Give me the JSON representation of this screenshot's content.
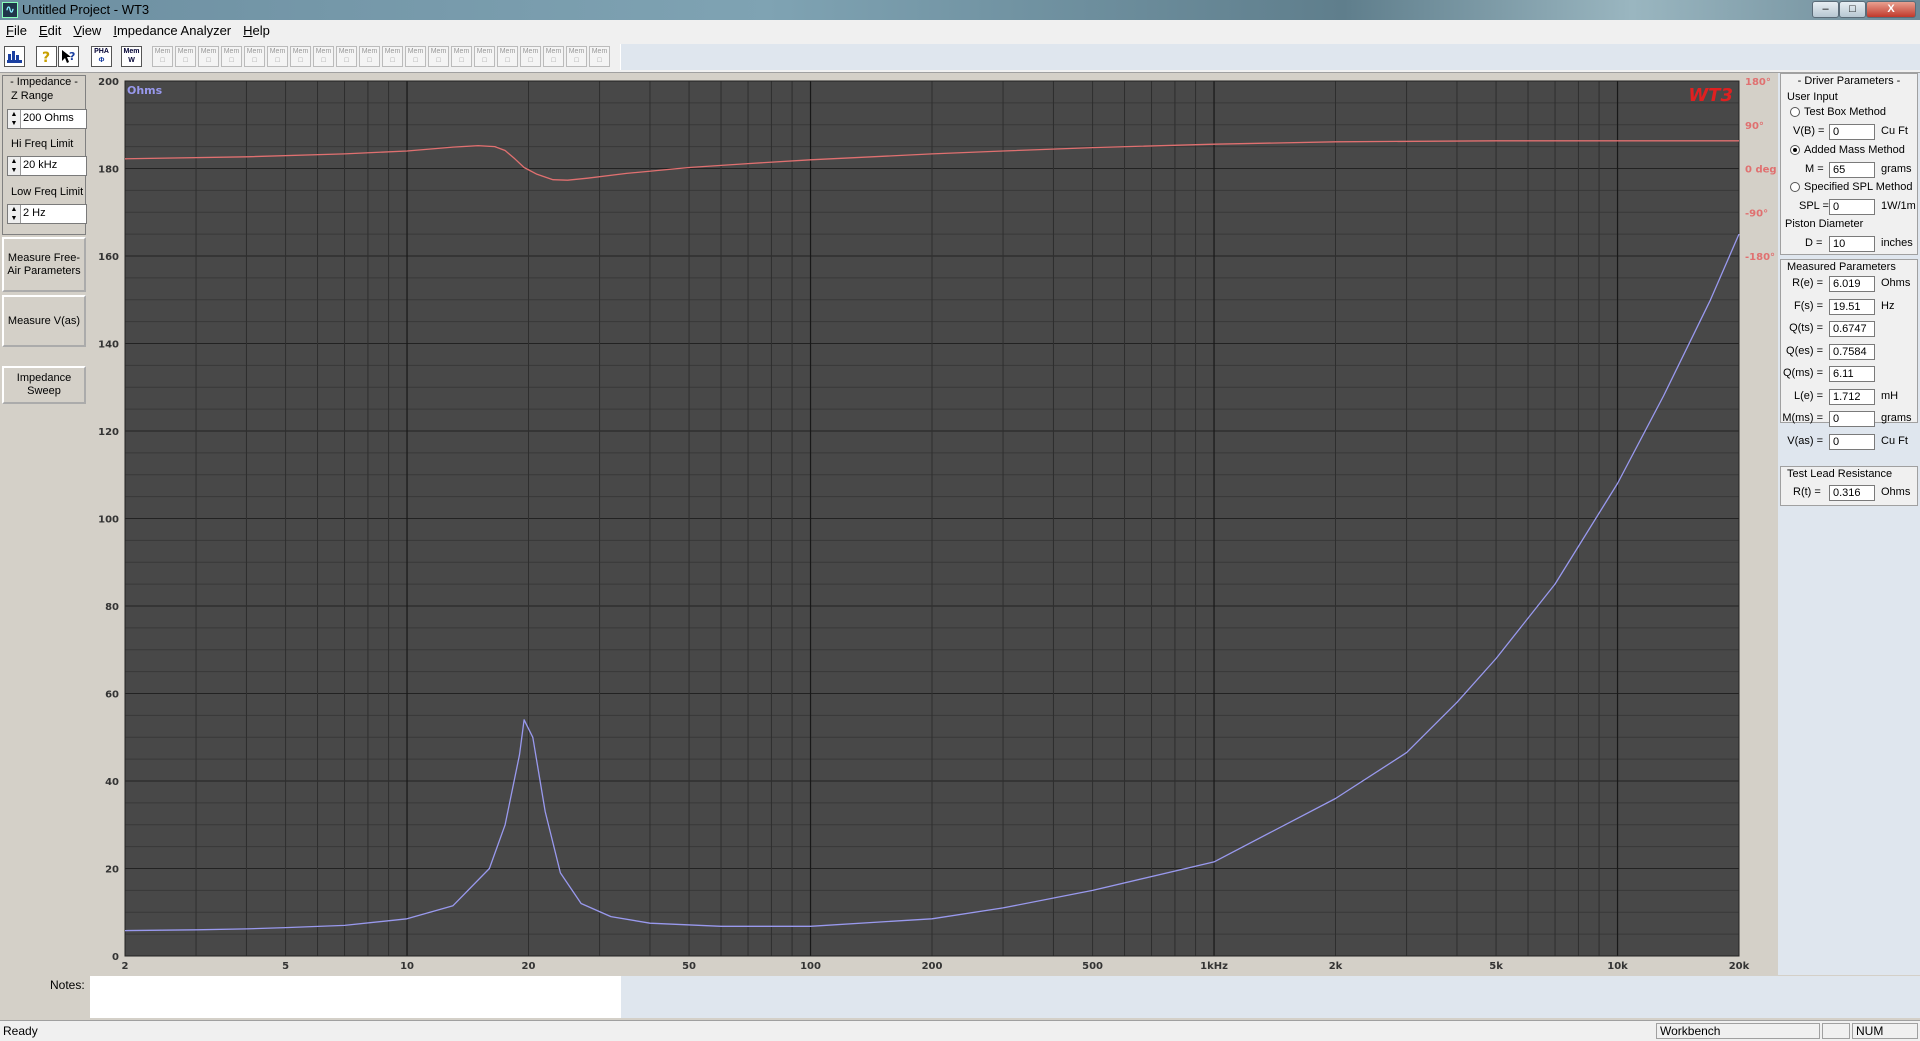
{
  "window": {
    "title": "Untitled Project - WT3",
    "min_glyph": "–",
    "max_glyph": "□",
    "close_glyph": "X"
  },
  "menu": [
    {
      "label": "File",
      "u": "F",
      "rest": "ile"
    },
    {
      "label": "Edit",
      "u": "E",
      "rest": "dit"
    },
    {
      "label": "View",
      "u": "V",
      "rest": "iew"
    },
    {
      "label": "Impedance Analyzer",
      "u": "I",
      "rest": "mpedance Analyzer"
    },
    {
      "label": "Help",
      "u": "H",
      "rest": "elp"
    }
  ],
  "toolbar": {
    "icons": [
      "graph-icon",
      "help-icon",
      "context-help-icon"
    ],
    "pha_label": "PHA",
    "mem_w_label": "Mem W",
    "mem_label": "Mem"
  },
  "left": {
    "group_title": "- Impedance -",
    "z_range_label": "Z Range",
    "z_range_value": "200 Ohms",
    "hi_freq_label": "Hi Freq Limit",
    "hi_freq_value": "20 kHz",
    "low_freq_label": "Low Freq Limit",
    "low_freq_value": "2 Hz",
    "measure_free_air": "Measure Free-Air Parameters",
    "measure_vas": "Measure V(as)",
    "impedance_sweep": "Impedance Sweep"
  },
  "chart_data": {
    "type": "line",
    "logo": "WT3",
    "ylabel": "Ohms",
    "ylim": [
      0,
      200
    ],
    "y_ticks": [
      0,
      20,
      40,
      60,
      80,
      100,
      120,
      140,
      160,
      180,
      200
    ],
    "x_scale": "log",
    "xlim": [
      2,
      20000
    ],
    "x_ticks": [
      {
        "v": 2,
        "label": "2"
      },
      {
        "v": 5,
        "label": "5"
      },
      {
        "v": 10,
        "label": "10"
      },
      {
        "v": 20,
        "label": "20"
      },
      {
        "v": 50,
        "label": "50"
      },
      {
        "v": 100,
        "label": "100"
      },
      {
        "v": 200,
        "label": "200"
      },
      {
        "v": 500,
        "label": "500"
      },
      {
        "v": 1000,
        "label": "1kHz"
      },
      {
        "v": 2000,
        "label": "2k"
      },
      {
        "v": 5000,
        "label": "5k"
      },
      {
        "v": 10000,
        "label": "10k"
      },
      {
        "v": 20000,
        "label": "20k"
      }
    ],
    "phase_ticks": [
      {
        "v": 180,
        "label": "180°"
      },
      {
        "v": 90,
        "label": "90°"
      },
      {
        "v": 0,
        "label": "0 deg"
      },
      {
        "v": -90,
        "label": "-90°"
      },
      {
        "v": -180,
        "label": "-180°"
      }
    ],
    "phase_lim": [
      -180,
      180
    ],
    "grid": true,
    "colors": {
      "background": "#484848",
      "impedance": "#9999ee",
      "phase": "#e07070",
      "logo": "#e02020"
    },
    "series": [
      {
        "key": "impedance",
        "axis": "ohms",
        "x": [
          2,
          3,
          4,
          5,
          7,
          10,
          13,
          16,
          17.5,
          19,
          19.5,
          20.5,
          22,
          24,
          27,
          32,
          40,
          60,
          100,
          200,
          300,
          500,
          1000,
          2000,
          3000,
          4000,
          5000,
          7000,
          10000,
          13000,
          17000,
          20000
        ],
        "y": [
          5.8,
          6,
          6.2,
          6.5,
          7,
          8.5,
          11.5,
          20,
          30,
          46,
          54,
          50,
          33,
          19,
          12,
          9,
          7.5,
          6.8,
          6.8,
          8.5,
          11,
          15,
          21.5,
          36,
          46.5,
          58,
          68,
          85,
          108,
          128,
          150,
          165
        ]
      },
      {
        "key": "phase",
        "axis": "degrees",
        "x": [
          2,
          4,
          7,
          10,
          13,
          15,
          16.5,
          17.5,
          18.5,
          19.5,
          21,
          23,
          25,
          28,
          35,
          50,
          70,
          100,
          200,
          300,
          500,
          1000,
          2000,
          5000,
          10000,
          20000
        ],
        "y": [
          20,
          24,
          30,
          36,
          44,
          47,
          45,
          37,
          20,
          2,
          -12,
          -23,
          -24,
          -20,
          -10,
          2,
          10,
          18,
          30,
          36,
          43,
          50,
          55,
          57,
          57,
          57
        ]
      }
    ]
  },
  "right": {
    "driver_params_title": "- Driver Parameters -",
    "user_input_title": "User Input",
    "test_box_method": "Test Box Method",
    "vb_label": "V(B) =",
    "vb_value": "0",
    "vb_unit": "Cu Ft",
    "added_mass_method": "Added Mass Method",
    "m_label": "M =",
    "m_value": "65",
    "m_unit": "grams",
    "spl_method": "Specified SPL Method",
    "spl_label": "SPL =",
    "spl_value": "0",
    "spl_unit": "1W/1m",
    "piston_label": "Piston Diameter",
    "d_label": "D =",
    "d_value": "10",
    "d_unit": "inches",
    "measured_title": "Measured Parameters",
    "measured": [
      {
        "label": "R(e) =",
        "value": "6.019",
        "unit": "Ohms"
      },
      {
        "label": "F(s) =",
        "value": "19.51",
        "unit": "Hz"
      },
      {
        "label": "Q(ts) =",
        "value": "0.6747",
        "unit": ""
      },
      {
        "label": "Q(es) =",
        "value": "0.7584",
        "unit": ""
      },
      {
        "label": "Q(ms) =",
        "value": "6.11",
        "unit": ""
      },
      {
        "label": "L(e) =",
        "value": "1.712",
        "unit": "mH"
      },
      {
        "label": "M(ms) =",
        "value": "0",
        "unit": "grams"
      },
      {
        "label": "V(as) =",
        "value": "0",
        "unit": "Cu Ft"
      }
    ],
    "test_lead_title": "Test Lead Resistance",
    "rt_label": "R(t) =",
    "rt_value": "0.316",
    "rt_unit": "Ohms"
  },
  "notes_label": "Notes:",
  "status": {
    "text": "Ready",
    "workbench": "Workbench",
    "num": "NUM"
  }
}
